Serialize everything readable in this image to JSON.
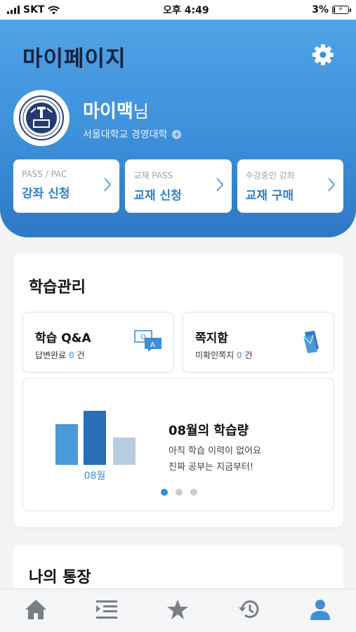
{
  "status_bar": {
    "carrier": "SKT",
    "time": "오후 4:49",
    "battery": "3%"
  },
  "header": {
    "title": "마이페이지",
    "settings_icon": "gear-icon"
  },
  "profile": {
    "name": "마이맥",
    "suffix": "님",
    "school": "서울대학교 경영대학",
    "logo_icon": "university-seal-icon"
  },
  "quick_cards": [
    {
      "small": "PASS / PAC",
      "big": "강좌 신청"
    },
    {
      "small": "교재 PASS",
      "big": "교재 신청"
    },
    {
      "small": "수강중인 강좌",
      "big": "교재 구매"
    }
  ],
  "study": {
    "title": "학습관리",
    "qa": {
      "title": "학습 Q&A",
      "label": "답변완료",
      "count": "0",
      "unit": "건",
      "icon": "qa-chat-icon"
    },
    "note": {
      "title": "쪽지함",
      "label": "미확인쪽지",
      "count": "0",
      "unit": "건",
      "icon": "envelope-icon"
    },
    "chart": {
      "month_label": "08월",
      "title": "08월의 학습량",
      "line1": "아직 학습 이력이 없어요",
      "line2": "진짜 공부는 지금부터!",
      "colors": {
        "left": "#4a9ad9",
        "center": "#2a6fb5",
        "right": "#b8cde0",
        "label": "#3d8fd9"
      }
    },
    "carousel": {
      "count": 3,
      "active": 1
    }
  },
  "account": {
    "title": "나의 통장"
  },
  "tabs": [
    {
      "name": "tab-home",
      "icon": "home-icon"
    },
    {
      "name": "tab-lectures",
      "icon": "indent-list-icon"
    },
    {
      "name": "tab-favorites",
      "icon": "star-icon"
    },
    {
      "name": "tab-history",
      "icon": "history-icon"
    },
    {
      "name": "tab-mypage",
      "icon": "user-icon",
      "active": true
    }
  ],
  "colors": {
    "accent": "#3d8fd9",
    "tab_active": "#3d8fd9",
    "tab_inactive": "#7a7f86"
  }
}
